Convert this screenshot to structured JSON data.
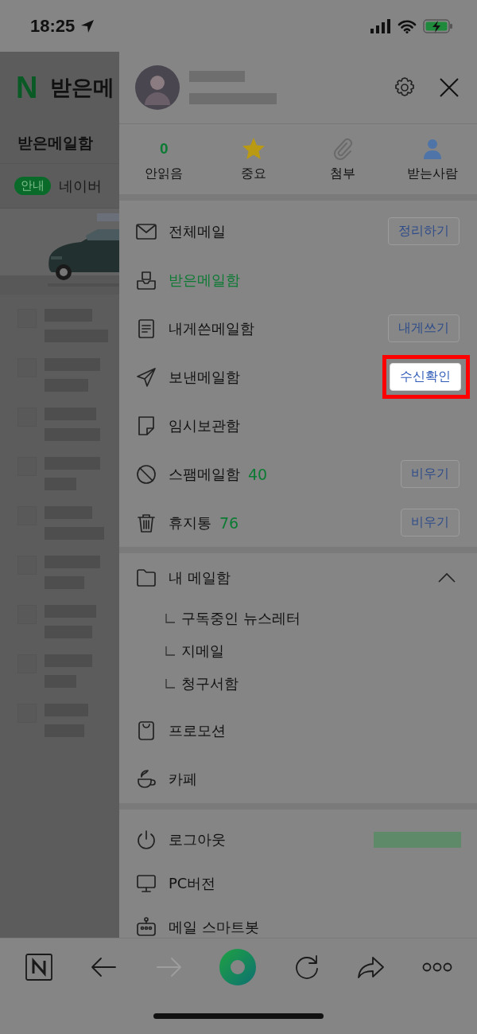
{
  "status_bar": {
    "time": "18:25"
  },
  "background_app": {
    "logo": "N",
    "title": "받은메",
    "tab": "받은메일함",
    "notice": {
      "badge": "안내",
      "text": "네이버"
    }
  },
  "drawer": {
    "quick_filters": [
      {
        "kind": "count",
        "count": "0",
        "label": "안읽음"
      },
      {
        "kind": "star",
        "label": "중요"
      },
      {
        "kind": "clip",
        "label": "첨부"
      },
      {
        "kind": "person",
        "label": "받는사람"
      }
    ],
    "folders": [
      {
        "kind": "envelope",
        "label": "전체메일",
        "selected": false,
        "action": {
          "label": "정리하기",
          "highlighted": false
        }
      },
      {
        "kind": "inbox",
        "label": "받은메일함",
        "selected": true
      },
      {
        "kind": "memo",
        "label": "내게쓴메일함",
        "selected": false,
        "action": {
          "label": "내게쓰기",
          "highlighted": false
        }
      },
      {
        "kind": "send",
        "label": "보낸메일함",
        "selected": false,
        "action": {
          "label": "수신확인",
          "highlighted": true
        }
      },
      {
        "kind": "draft",
        "label": "임시보관함",
        "selected": false
      },
      {
        "kind": "spam",
        "label": "스팸메일함",
        "count": "40",
        "selected": false,
        "action": {
          "label": "비우기",
          "highlighted": false
        }
      },
      {
        "kind": "trash",
        "label": "휴지통",
        "count": "76",
        "selected": false,
        "action": {
          "label": "비우기",
          "highlighted": false
        }
      }
    ],
    "my_mailbox": {
      "label": "내 메일함",
      "expanded": true,
      "children": [
        {
          "label": "구독중인 뉴스레터"
        },
        {
          "label": "지메일"
        },
        {
          "label": "청구서함"
        }
      ]
    },
    "extras": [
      {
        "kind": "bag",
        "label": "프로모션"
      },
      {
        "kind": "cup",
        "label": "카페"
      }
    ],
    "account": [
      {
        "kind": "power",
        "label": "로그아웃"
      },
      {
        "kind": "monitor",
        "label": "PC버전"
      },
      {
        "kind": "robot",
        "label": "메일 스마트봇"
      }
    ]
  },
  "toolbar": [
    {
      "kind": "n",
      "disabled": false
    },
    {
      "kind": "back",
      "disabled": false
    },
    {
      "kind": "forward",
      "disabled": true
    },
    {
      "kind": "ring",
      "disabled": false
    },
    {
      "kind": "refresh",
      "disabled": false
    },
    {
      "kind": "share",
      "disabled": false
    },
    {
      "kind": "more",
      "disabled": false
    }
  ]
}
